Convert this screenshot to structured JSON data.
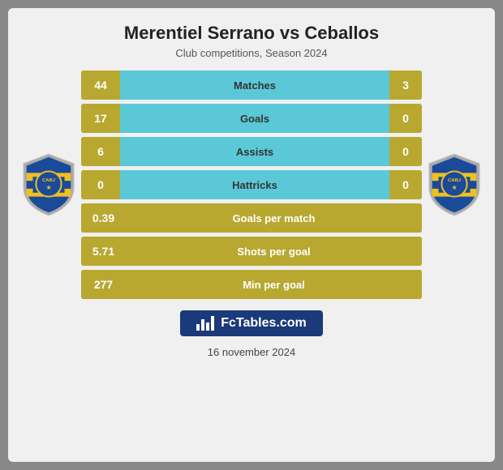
{
  "header": {
    "title": "Merentiel Serrano vs Ceballos",
    "subtitle": "Club competitions, Season 2024"
  },
  "stats": [
    {
      "id": "matches",
      "label": "Matches",
      "left_val": "44",
      "right_val": "3",
      "has_right": true
    },
    {
      "id": "goals",
      "label": "Goals",
      "left_val": "17",
      "right_val": "0",
      "has_right": true
    },
    {
      "id": "assists",
      "label": "Assists",
      "left_val": "6",
      "right_val": "0",
      "has_right": true
    },
    {
      "id": "hattricks",
      "label": "Hattricks",
      "left_val": "0",
      "right_val": "0",
      "has_right": true
    },
    {
      "id": "goals_per_match",
      "label": "Goals per match",
      "left_val": "0.39",
      "has_right": false
    },
    {
      "id": "shots_per_goal",
      "label": "Shots per goal",
      "left_val": "5.71",
      "has_right": false
    },
    {
      "id": "min_per_goal",
      "label": "Min per goal",
      "left_val": "277",
      "has_right": false
    }
  ],
  "branding": {
    "text": "FcTables.com"
  },
  "footer": {
    "date": "16 november 2024"
  },
  "colors": {
    "accent": "#b8a830",
    "bar": "#5bc8d8",
    "brand_bg": "#1a3a7a"
  }
}
